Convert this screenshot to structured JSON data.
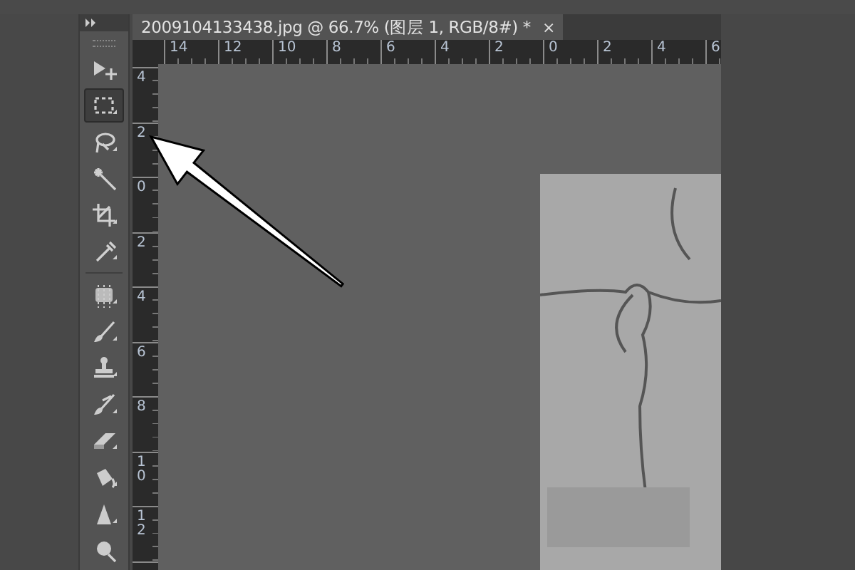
{
  "toolbox": {
    "tools": [
      {
        "kind": "move",
        "selected": false
      },
      {
        "kind": "marquee",
        "selected": true
      },
      {
        "kind": "lasso",
        "selected": false
      },
      {
        "kind": "wand",
        "selected": false
      },
      {
        "kind": "crop",
        "selected": false
      },
      {
        "kind": "eyedropper",
        "selected": false
      },
      {
        "kind": "healing",
        "selected": false
      },
      {
        "kind": "brush",
        "selected": false
      },
      {
        "kind": "stamp",
        "selected": false
      },
      {
        "kind": "history",
        "selected": false
      },
      {
        "kind": "eraser",
        "selected": false
      },
      {
        "kind": "bucket",
        "selected": false
      },
      {
        "kind": "blur",
        "selected": false
      },
      {
        "kind": "zoom",
        "selected": false
      }
    ]
  },
  "document": {
    "tab": {
      "title": "2009104133438.jpg @ 66.7% (图层 1, RGB/8#) *",
      "close": "×"
    },
    "horizontal_ruler": {
      "labels": [
        "14",
        "12",
        "10",
        "8",
        "6",
        "4",
        "2",
        "0",
        "2",
        "4",
        "6"
      ]
    },
    "vertical_ruler": {
      "labels": [
        "4",
        "2",
        "0",
        "2",
        "4",
        "6",
        "8",
        "10",
        "12"
      ]
    }
  }
}
